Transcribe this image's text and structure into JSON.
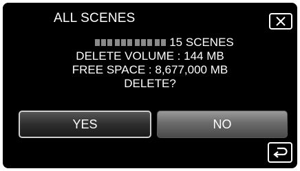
{
  "dialog": {
    "title": "ALL SCENES",
    "count_text": "15 SCENES",
    "delete_volume": "DELETE VOLUME : 144 MB",
    "free_space": "FREE SPACE : 8,677,000 MB",
    "question": "DELETE?"
  },
  "buttons": {
    "yes_label": "YES",
    "no_label": "NO"
  },
  "icons": {
    "close": "close-icon",
    "back": "return-arrow-icon"
  }
}
